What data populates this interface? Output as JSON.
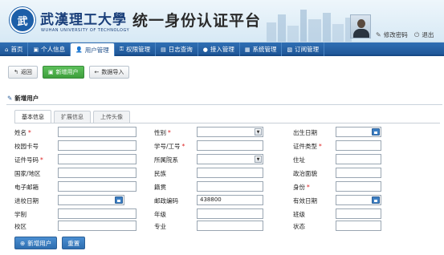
{
  "header": {
    "logo_cn": "武漢理工大學",
    "logo_en": "WUHAN UNIVERSITY OF TECHNOLOGY",
    "site_title": "统一身份认证平台",
    "change_password": "修改密码",
    "logout": "退出"
  },
  "nav": {
    "items": [
      {
        "label": "首页",
        "icon": "home-icon"
      },
      {
        "label": "个人信息",
        "icon": "user-card-icon"
      },
      {
        "label": "用户管理",
        "icon": "users-icon",
        "active": true
      },
      {
        "label": "权限管理",
        "icon": "key-icon"
      },
      {
        "label": "日志查询",
        "icon": "log-icon"
      },
      {
        "label": "接入管理",
        "icon": "plug-icon"
      },
      {
        "label": "系统管理",
        "icon": "system-icon"
      },
      {
        "label": "订阅管理",
        "icon": "subscribe-icon"
      }
    ]
  },
  "toolbar": {
    "back": "返回",
    "add_user": "新增用户",
    "import": "数据导入"
  },
  "section": {
    "title": "新增用户"
  },
  "tabs": [
    "基本信息",
    "扩展信息",
    "上传头像"
  ],
  "form": {
    "fields": [
      {
        "label": "姓名",
        "required": true,
        "value": ""
      },
      {
        "label": "性别",
        "required": true,
        "value": "",
        "type": "select"
      },
      {
        "label": "出生日期",
        "required": false,
        "value": "",
        "type": "date"
      },
      {
        "label": "校园卡号",
        "required": false,
        "value": ""
      },
      {
        "label": "学号/工号",
        "required": true,
        "value": ""
      },
      {
        "label": "证件类型",
        "required": true,
        "value": ""
      },
      {
        "label": "证件号码",
        "required": true,
        "value": ""
      },
      {
        "label": "所属院系",
        "required": false,
        "value": "",
        "type": "select"
      },
      {
        "label": "住址",
        "required": false,
        "value": ""
      },
      {
        "label": "国家/地区",
        "required": false,
        "value": ""
      },
      {
        "label": "民族",
        "required": false,
        "value": ""
      },
      {
        "label": "政治面貌",
        "required": false,
        "value": ""
      },
      {
        "label": "电子邮箱",
        "required": false,
        "value": ""
      },
      {
        "label": "籍贯",
        "required": false,
        "value": ""
      },
      {
        "label": "身份",
        "required": true,
        "value": ""
      },
      {
        "label": "进校日期",
        "required": false,
        "value": "",
        "type": "date"
      },
      {
        "label": "邮政编码",
        "required": false,
        "value": "438800"
      },
      {
        "label": "有效日期",
        "required": false,
        "value": "",
        "type": "date"
      },
      {
        "label": "学制",
        "required": false,
        "value": ""
      },
      {
        "label": "年级",
        "required": false,
        "value": ""
      },
      {
        "label": "班级",
        "required": false,
        "value": ""
      },
      {
        "label": "校区",
        "required": false,
        "value": ""
      },
      {
        "label": "专业",
        "required": false,
        "value": ""
      },
      {
        "label": "状态",
        "required": false,
        "value": ""
      }
    ]
  },
  "bottom": {
    "add_user": "新增用户",
    "reset": "重置"
  }
}
